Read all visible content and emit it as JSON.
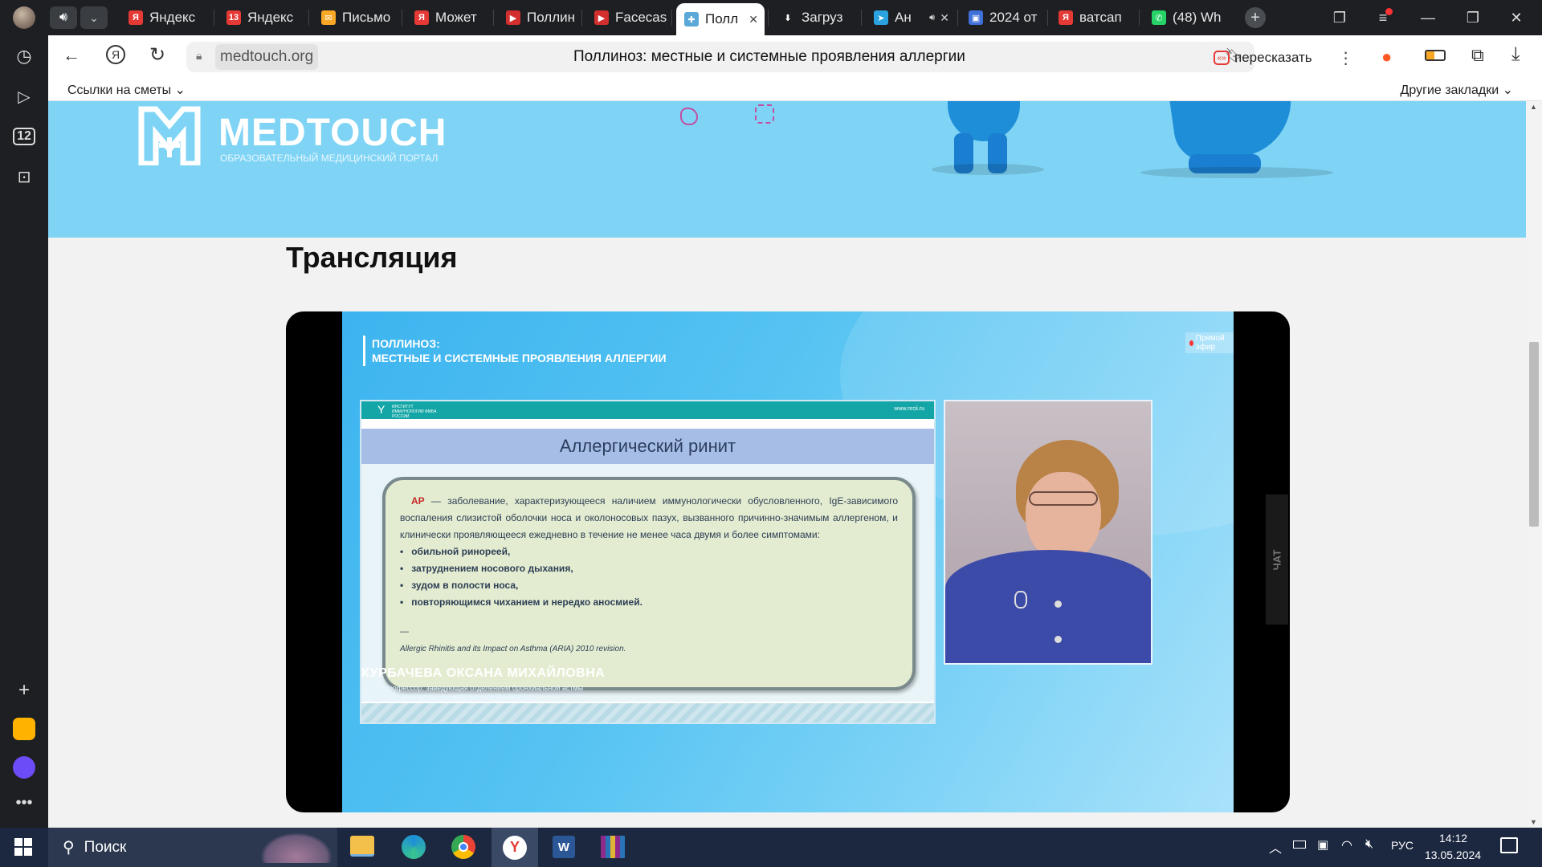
{
  "tabs": [
    {
      "label": "Яндекс",
      "fav": "Я",
      "color": "#e53935"
    },
    {
      "label": "Яндекс",
      "fav": "13",
      "color": "#e53935"
    },
    {
      "label": "Письмо",
      "fav": "✉",
      "color": "#f9a825"
    },
    {
      "label": "Может",
      "fav": "Я",
      "color": "#e53935"
    },
    {
      "label": "Поллин",
      "fav": "▶",
      "color": "#d32f2f"
    },
    {
      "label": "Facecas",
      "fav": "▶",
      "color": "#d32f2f"
    },
    {
      "label": "Полл",
      "fav": "✚",
      "color": "#5aa7d8"
    },
    {
      "label": "Загруз",
      "fav": "⬇",
      "color": "#1d1f23"
    },
    {
      "label": "Ан",
      "fav": "➤",
      "color": "#2aa3e0"
    },
    {
      "label": "2024 от",
      "fav": "▣",
      "color": "#3f6fd8"
    },
    {
      "label": "ватсап",
      "fav": "Я",
      "color": "#e53935"
    },
    {
      "label": "(48) Wh",
      "fav": "✆",
      "color": "#25d366"
    }
  ],
  "address": {
    "url": "medtouch.org",
    "page_title": "Поллиноз: местные и системные проявления аллергии",
    "retell": "пересказать"
  },
  "bookmarks": {
    "left": "Ссылки на сметы",
    "right": "Другие закладки"
  },
  "sidebar": {
    "badge": "12"
  },
  "site": {
    "logo": "MEDTOUCH",
    "logo_sub": "ОБРАЗОВАТЕЛЬНЫЙ МЕДИЦИНСКИЙ ПОРТАЛ",
    "section_title": "Трансляция"
  },
  "video": {
    "heading1": "ПОЛЛИНОЗ:",
    "heading2": "МЕСТНЫЕ И СИСТЕМНЫЕ ПРОЯВЛЕНИЯ АЛЛЕРГИИ",
    "live": "Прямой эфир",
    "slide_header_left": "ИНСТИТУТ ИММУНОЛОГИИ ФМБА РОССИИ",
    "slide_header_right": "www.nrcii.ru",
    "slide_title": "Аллергический ринит",
    "slide_abbr": "АР",
    "slide_text": "— заболевание, характеризующееся наличием иммунологически обусловленного, IgE-зависимого воспаления слизистой оболочки носа и околоносовых пазух, вызванного причинно-значимым аллергеном, и клинически проявляющееся ежедневно в течение не менее часа двумя и более симптомами:",
    "slide_bullets": [
      "обильной ринореей,",
      "затруднением носового дыхания,",
      "зудом в полости носа,",
      "повторяющимся чиханием и нередко аносмией."
    ],
    "slide_dash": "—",
    "slide_source": "Allergic Rhinitis and its Impact on Asthma (ARIA) 2010 revision.",
    "speaker_name": "КУРБАЧЕВА ОКСАНА МИХАЙЛОВНА",
    "speaker_role1": "д.м.н., профессор, заведующая отделением бронхиальной астмы",
    "speaker_role2": "ФГБУ ГНЦ «Институт иммунологии» ФМБА России",
    "chat": "ЧАТ"
  },
  "taskbar": {
    "search": "Поиск",
    "lang": "РУС",
    "time": "14:12",
    "date": "13.05.2024"
  }
}
